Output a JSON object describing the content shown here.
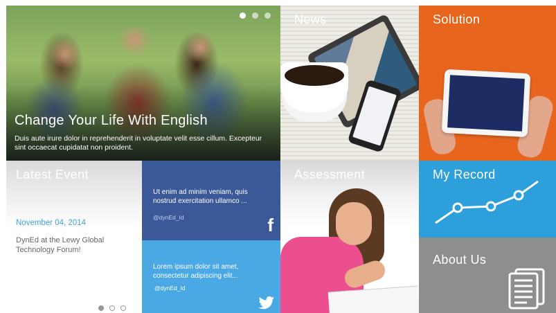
{
  "hero": {
    "title": "Change Your Life With English",
    "text": "Duis aute irure dolor in reprehenderit in voluptate velit esse cillum. Excepteur sint occaecat cupidatat non proident.",
    "slide_count": 3,
    "active_slide": 1
  },
  "news": {
    "title": "News"
  },
  "solution": {
    "title": "Solution"
  },
  "event": {
    "title": "Latest Event",
    "date": "November 04, 2014",
    "text": "DynEd at the Lewy Global Technology Forum!",
    "slide_count": 3,
    "active_slide": 1
  },
  "facebook": {
    "text": "Ut enim ad minim veniam, quis nostrud exercitation ullamco ...",
    "handle": "@dynEd_Id",
    "icon": "facebook-icon"
  },
  "twitter": {
    "text": "Lorem ipsum dolor sit amet, consectetur adipiscing elit...",
    "handle": "@dynEd_Id",
    "icon": "twitter-icon"
  },
  "assessment": {
    "title": "Assessment"
  },
  "record": {
    "title": "My Record",
    "icon": "line-chart-icon"
  },
  "about": {
    "title": "About Us",
    "icon": "document-icon"
  },
  "colors": {
    "facebook": "#3b5999",
    "twitter": "#4aa8e4",
    "solution": "#e8651e",
    "record": "#2d9fdb",
    "about": "#8e8e8e",
    "event_date": "#3ea4dd"
  }
}
